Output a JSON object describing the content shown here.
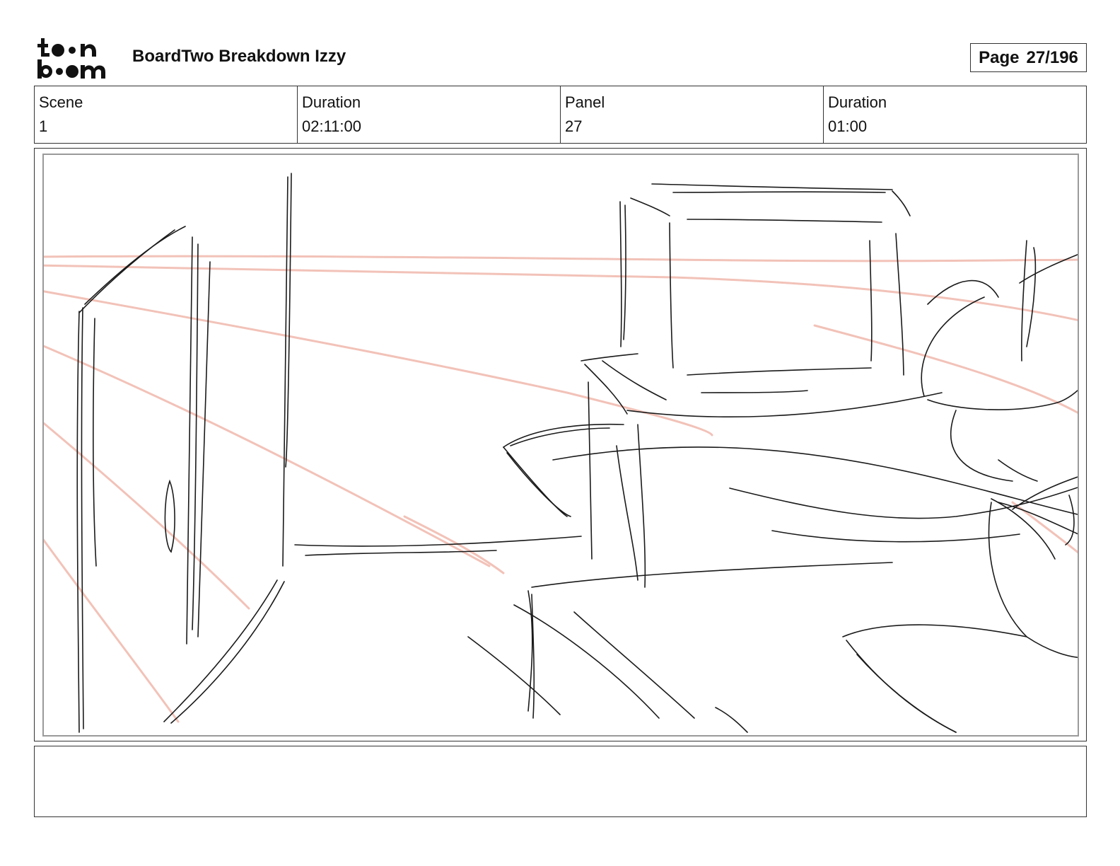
{
  "header": {
    "logo_text": "toonboom",
    "title": "BoardTwo Breakdown Izzy",
    "page_label": "Page",
    "page_value": "27/196"
  },
  "info": {
    "scene_label": "Scene",
    "scene_value": "1",
    "scene_duration_label": "Duration",
    "scene_duration_value": "02:11:00",
    "panel_label": "Panel",
    "panel_value": "27",
    "panel_duration_label": "Duration",
    "panel_duration_value": "01:00"
  },
  "notes": {
    "text": ""
  },
  "colors": {
    "sketch_line": "#1a1a1a",
    "guide_line": "#f2c2b8",
    "frame": "#9a9a9a"
  }
}
